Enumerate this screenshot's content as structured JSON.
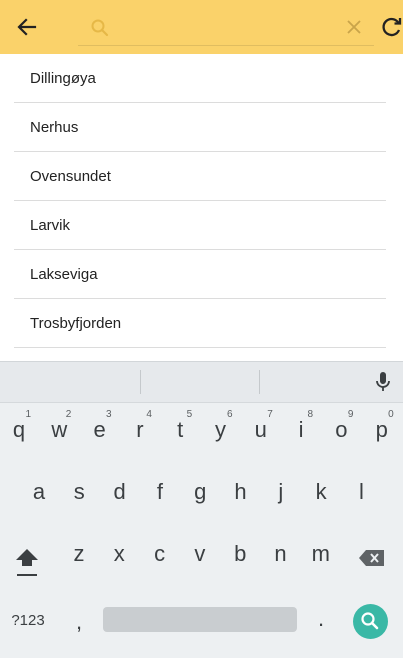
{
  "appbar": {
    "search_placeholder": ""
  },
  "places": [
    "Dillingøya",
    "Nerhus",
    "Ovensundet",
    "Larvik",
    "Lakseviga",
    "Trosbyfjorden"
  ],
  "keyboard": {
    "row1": [
      {
        "char": "q",
        "hint": "1"
      },
      {
        "char": "w",
        "hint": "2"
      },
      {
        "char": "e",
        "hint": "3"
      },
      {
        "char": "r",
        "hint": "4"
      },
      {
        "char": "t",
        "hint": "5"
      },
      {
        "char": "y",
        "hint": "6"
      },
      {
        "char": "u",
        "hint": "7"
      },
      {
        "char": "i",
        "hint": "8"
      },
      {
        "char": "o",
        "hint": "9"
      },
      {
        "char": "p",
        "hint": "0"
      }
    ],
    "row2": [
      "a",
      "s",
      "d",
      "f",
      "g",
      "h",
      "j",
      "k",
      "l"
    ],
    "row3": [
      "z",
      "x",
      "c",
      "v",
      "b",
      "n",
      "m"
    ],
    "symbols_label": "?123",
    "comma": ",",
    "period": "."
  },
  "icons": {
    "back": "arrow-left-icon",
    "search": "magnifier-icon",
    "clear": "close-icon",
    "refresh": "refresh-icon",
    "mic": "microphone-icon",
    "shift": "shift-icon",
    "backspace": "backspace-icon",
    "keyboard_search": "magnifier-icon"
  },
  "colors": {
    "appbar": "#fad26a",
    "accent": "#3ab8a6",
    "keyboard_bg": "#edf0f2"
  }
}
